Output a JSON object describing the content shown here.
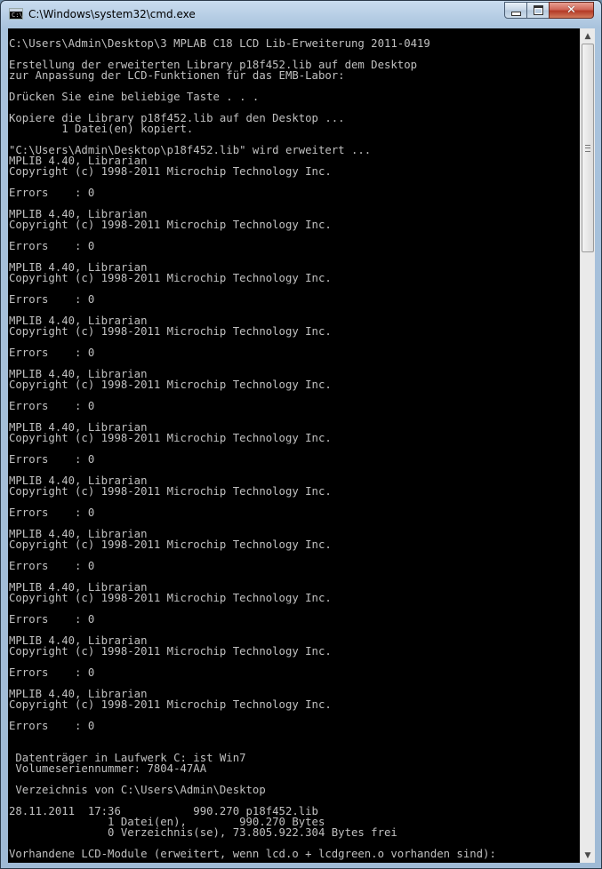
{
  "window": {
    "title": "C:\\Windows\\system32\\cmd.exe",
    "app_icon_label": "C:\\",
    "controls": {
      "minimize_icon": "minimize-icon",
      "maximize_icon": "maximize-icon",
      "close_icon": "close-icon",
      "close_glyph": "✕"
    }
  },
  "scrollbar": {
    "up_glyph": "▲",
    "down_glyph": "▼"
  },
  "colors": {
    "console_background": "#000000",
    "console_text": "#c0c0c0",
    "close_button": "#c4452f"
  },
  "console": {
    "lines": [
      "C:\\Users\\Admin\\Desktop\\3 MPLAB C18 LCD Lib-Erweiterung 2011-0419",
      "",
      "Erstellung der erweiterten Library p18f452.lib auf dem Desktop",
      "zur Anpassung der LCD-Funktionen für das EMB-Labor:",
      "",
      "Drücken Sie eine beliebige Taste . . .",
      "",
      "Kopiere die Library p18f452.lib auf den Desktop ...",
      "        1 Datei(en) kopiert.",
      "",
      "\"C:\\Users\\Admin\\Desktop\\p18f452.lib\" wird erweitert ...",
      "MPLIB 4.40, Librarian",
      "Copyright (c) 1998-2011 Microchip Technology Inc.",
      "",
      "Errors    : 0",
      "",
      "MPLIB 4.40, Librarian",
      "Copyright (c) 1998-2011 Microchip Technology Inc.",
      "",
      "Errors    : 0",
      "",
      "MPLIB 4.40, Librarian",
      "Copyright (c) 1998-2011 Microchip Technology Inc.",
      "",
      "Errors    : 0",
      "",
      "MPLIB 4.40, Librarian",
      "Copyright (c) 1998-2011 Microchip Technology Inc.",
      "",
      "Errors    : 0",
      "",
      "MPLIB 4.40, Librarian",
      "Copyright (c) 1998-2011 Microchip Technology Inc.",
      "",
      "Errors    : 0",
      "",
      "MPLIB 4.40, Librarian",
      "Copyright (c) 1998-2011 Microchip Technology Inc.",
      "",
      "Errors    : 0",
      "",
      "MPLIB 4.40, Librarian",
      "Copyright (c) 1998-2011 Microchip Technology Inc.",
      "",
      "Errors    : 0",
      "",
      "MPLIB 4.40, Librarian",
      "Copyright (c) 1998-2011 Microchip Technology Inc.",
      "",
      "Errors    : 0",
      "",
      "MPLIB 4.40, Librarian",
      "Copyright (c) 1998-2011 Microchip Technology Inc.",
      "",
      "Errors    : 0",
      "",
      "MPLIB 4.40, Librarian",
      "Copyright (c) 1998-2011 Microchip Technology Inc.",
      "",
      "Errors    : 0",
      "",
      "MPLIB 4.40, Librarian",
      "Copyright (c) 1998-2011 Microchip Technology Inc.",
      "",
      "Errors    : 0",
      "",
      "",
      " Datenträger in Laufwerk C: ist Win7",
      " Volumeseriennummer: 7804-47AA",
      "",
      " Verzeichnis von C:\\Users\\Admin\\Desktop",
      "",
      "28.11.2011  17:36           990.270 p18f452.lib",
      "               1 Datei(en),        990.270 Bytes",
      "               0 Verzeichnis(se), 73.805.922.304 Bytes frei",
      "",
      "Vorhandene LCD-Module (erweitert, wenn lcd.o + lcdgreen.o vorhanden sind):"
    ]
  }
}
